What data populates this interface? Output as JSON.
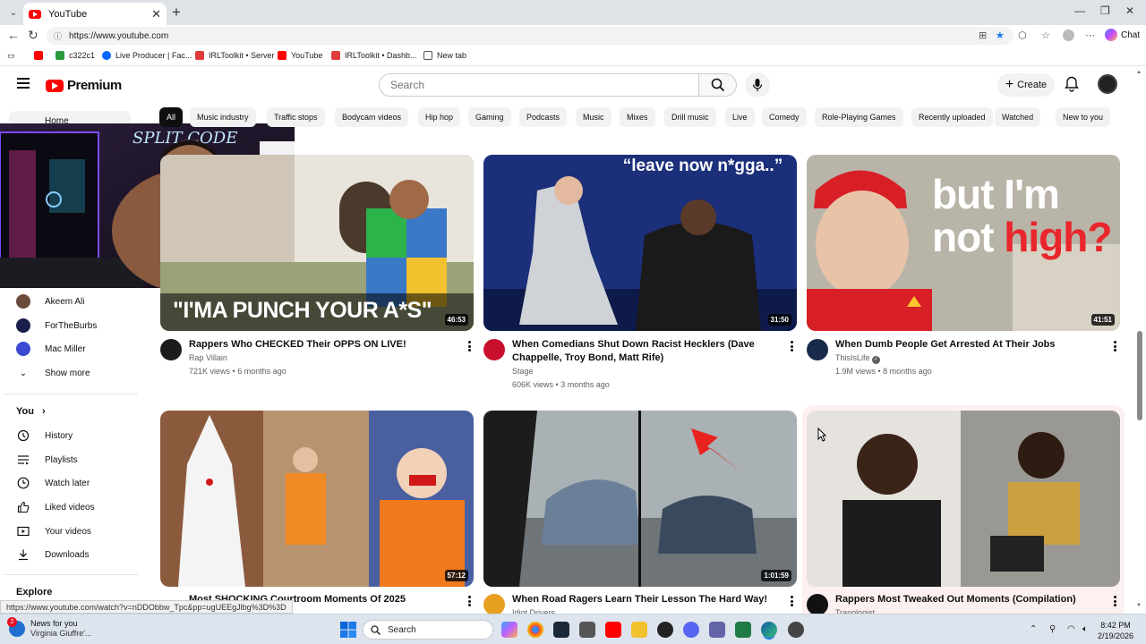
{
  "browser": {
    "tab_title": "YouTube",
    "url": "https://www.youtube.com",
    "chat_label": "Chat",
    "bookmarks": [
      "c322c1",
      "Live Producer | Fac...",
      "IRLToolkit • Server",
      "YouTube",
      "IRLToolkit • Dashb...",
      "New tab"
    ]
  },
  "youtube": {
    "logo_text": "Premium",
    "search_placeholder": "Search",
    "create_label": "Create"
  },
  "sidebar": {
    "home": "Home",
    "subscriptions": [
      "Akeem Ali",
      "ForTheBurbs",
      "Mac Miller"
    ],
    "show_more": "Show more",
    "you_header": "You",
    "you_items": [
      "History",
      "Playlists",
      "Watch later",
      "Liked videos",
      "Your videos",
      "Downloads"
    ],
    "explore_header": "Explore"
  },
  "chips": [
    "All",
    "Music industry",
    "Traffic stops",
    "Bodycam videos",
    "Hip hop",
    "Gaming",
    "Podcasts",
    "Music",
    "Mixes",
    "Drill music",
    "Live",
    "Comedy",
    "Role-Playing Games",
    "Recently uploaded",
    "Watched",
    "New to you"
  ],
  "videos": [
    {
      "title": "Rappers Who CHECKED Their OPPS ON LIVE!",
      "channel": "Rap Villain",
      "views": "721K views",
      "age": "6 months ago",
      "duration": "46:53",
      "thumb_text": "\"I'MA PUNCH YOUR A*S\""
    },
    {
      "title": "When Comedians Shut Down Racist Hecklers (Dave Chappelle, Troy Bond, Matt Rife)",
      "channel": "Stage",
      "views": "606K views",
      "age": "3 months ago",
      "duration": "31:50",
      "thumb_text": "“leave now n*gga..”"
    },
    {
      "title": "When Dumb People Get Arrested At Their Jobs",
      "channel": "ThisIsLife",
      "views": "1.9M views",
      "age": "8 months ago",
      "duration": "41:51",
      "thumb_text_1": "but I'm",
      "thumb_text_2": "not",
      "thumb_text_3": "high?"
    },
    {
      "title": "Most SHOCKING Courtroom Moments Of 2025",
      "channel": "",
      "duration": "57:12"
    },
    {
      "title": "When Road Ragers Learn Their Lesson The Hard Way!",
      "channel": "Idiot Drivers",
      "duration": "1:01:59"
    },
    {
      "title": "Rappers Most Tweaked Out Moments (Compilation)",
      "channel": "Trapologist",
      "duration": ""
    }
  ],
  "status_url": "https://www.youtube.com/watch?v=nDDObbw_Tpc&pp=ugUEEgJlbg%3D%3D",
  "taskbar": {
    "news_title": "News for you",
    "news_sub": "Virginia Giuffre'...",
    "news_badge": "2",
    "search_label": "Search",
    "time": "8:42 PM",
    "date": "2/19/2026"
  }
}
